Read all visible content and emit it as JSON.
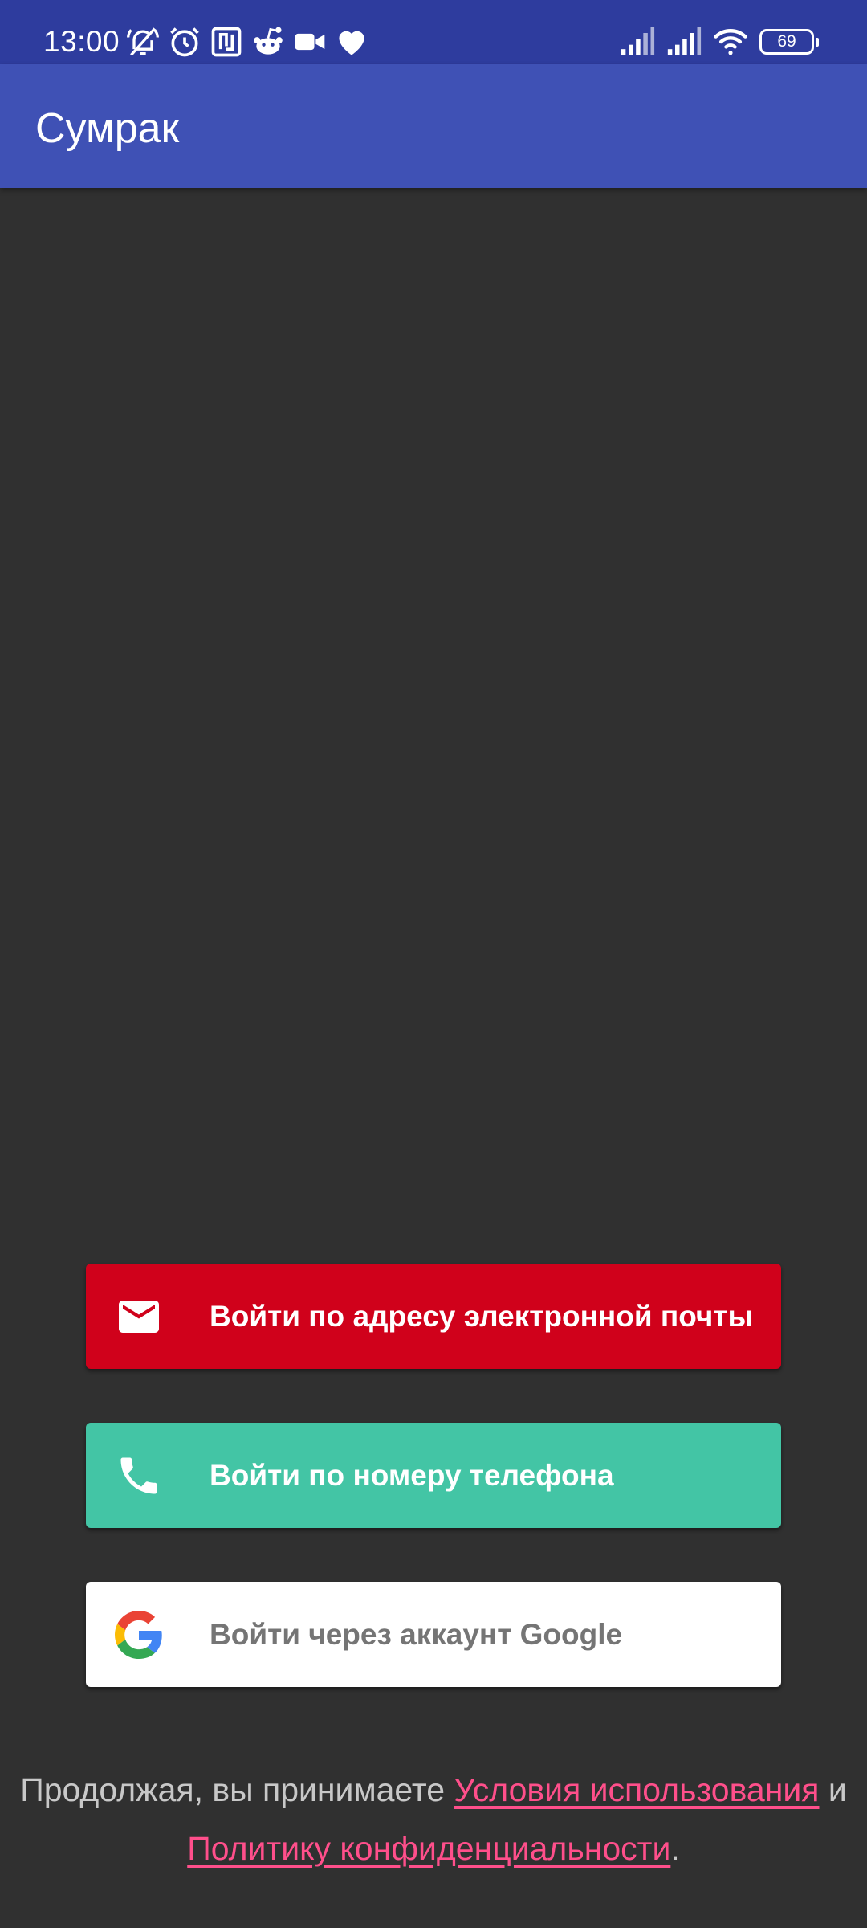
{
  "status_bar": {
    "time": "13:00",
    "battery_level": "69",
    "left_icons": [
      "muted-bell-icon",
      "alarm-icon",
      "nfc-icon",
      "reddit-icon",
      "video-camera-icon",
      "heart-icon"
    ],
    "right_icons": [
      "signal-icon",
      "signal-icon",
      "wifi-icon",
      "battery-icon"
    ]
  },
  "app_bar": {
    "title": "Сумрак",
    "color": "#3f51b5"
  },
  "sign_in": {
    "email": {
      "label": "Войти по адресу электронной почты",
      "icon": "email-icon",
      "color": "#d0011b"
    },
    "phone": {
      "label": "Войти по номеру телефона",
      "icon": "phone-icon",
      "color": "#43c5a5"
    },
    "google": {
      "label": "Войти через аккаунт Google",
      "icon": "google-logo-icon",
      "color": "#ffffff"
    }
  },
  "terms": {
    "prefix": "Продолжая, вы принимаете ",
    "terms_link": "Условия использования",
    "conjunction": " и ",
    "privacy_link": "Политику конфиденциальности",
    "suffix": ".",
    "link_color": "#ff4f8b"
  }
}
